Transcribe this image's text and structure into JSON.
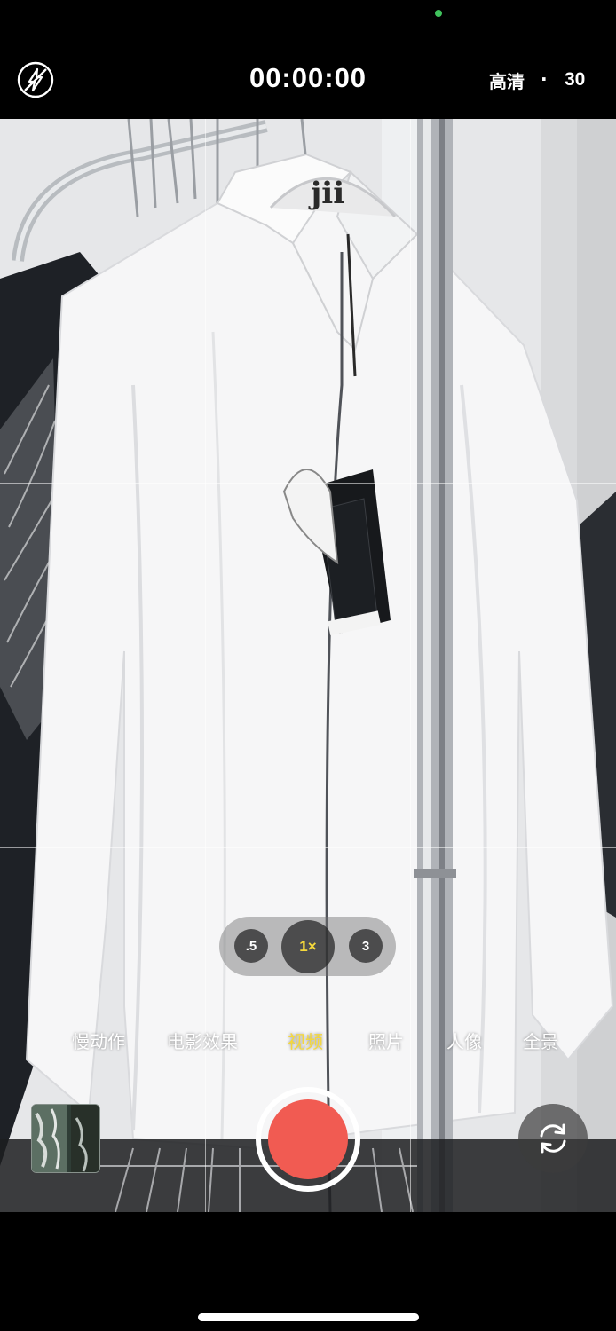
{
  "status": {
    "privacy_indicator_color": "#3fc25c"
  },
  "topbar": {
    "flash_icon": "flash-off-icon",
    "timer": "00:00:00",
    "quality": "高清",
    "separator": "·",
    "fps": "30"
  },
  "zoom": {
    "options": [
      ".5",
      "1×",
      "3"
    ],
    "selected": "1×",
    "active_color": "#f5d83b"
  },
  "modes": {
    "items": [
      "慢动作",
      "电影效果",
      "视频",
      "照片",
      "人像",
      "全景"
    ],
    "selected": "视频"
  },
  "controls": {
    "shutter_color": "#f15b52",
    "thumbnail_icon": "photo-thumbnail",
    "flip_icon": "camera-flip-icon"
  },
  "scene": {
    "shirt_label_text": "jii"
  }
}
